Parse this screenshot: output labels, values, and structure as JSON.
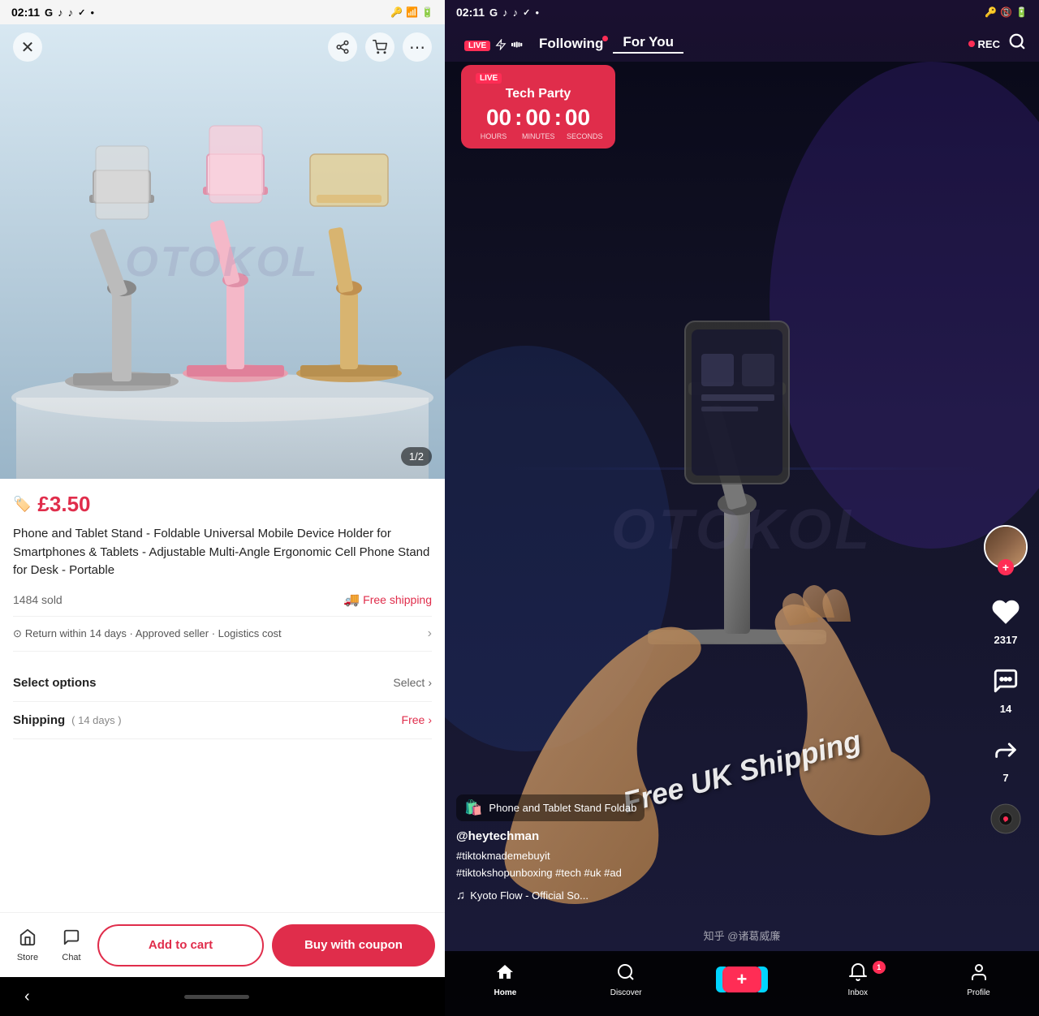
{
  "left": {
    "statusBar": {
      "time": "02:11",
      "icons": [
        "G",
        "tiktok",
        "tiktok2",
        "check",
        "signal"
      ]
    },
    "nav": {
      "close": "×",
      "share": "share",
      "cart": "cart",
      "more": "more"
    },
    "image": {
      "counter": "1/2",
      "altText": "Phone and Tablet Stand product image"
    },
    "product": {
      "priceIcon": "🏷",
      "price": "£3.50",
      "title": "Phone and Tablet Stand - Foldable Universal Mobile Device Holder for Smartphones & Tablets - Adjustable Multi-Angle Ergonomic Cell Phone Stand for Desk - Portable",
      "soldCount": "1484 sold",
      "freeShipping": "Free shipping",
      "returnText": "Return within 14 days · Approved seller · Logistics cost",
      "selectOptions": "Select options",
      "selectBtn": "Select",
      "shippingLabel": "Shipping",
      "shippingDays": "( 14 days )",
      "shippingCost": "Free"
    },
    "bottomBar": {
      "storeLabel": "Store",
      "chatLabel": "Chat",
      "addToCart": "Add to cart",
      "buyWithCoupon": "Buy with coupon"
    }
  },
  "right": {
    "statusBar": {
      "time": "02:11",
      "icons": [
        "G",
        "tiktok",
        "tiktok2",
        "check"
      ]
    },
    "topNav": {
      "live": "LIVE",
      "following": "Following",
      "forYou": "For You",
      "rec": "REC"
    },
    "liveCard": {
      "badge": "LIVE",
      "title": "Tech Party",
      "hours": "00",
      "minutes": "00",
      "seconds": "00",
      "hoursLabel": "HOURS",
      "minutesLabel": "MINUTES",
      "secondsLabel": "SECONDS"
    },
    "freeShippingOverlay": "Free UK Shipping",
    "productCard": {
      "name": "Phone and Tablet Stand  Foldab"
    },
    "userInfo": {
      "username": "@heytechman",
      "hashtags": "#tiktokmademebuyit\n#tiktokshopunboxing #tech #uk #ad",
      "music": "Kyoto Flow - Official So..."
    },
    "actions": {
      "likes": "2317",
      "comments": "14",
      "shares": "7"
    },
    "bottomNav": {
      "homeLabel": "Home",
      "discoverLabel": "Discover",
      "inboxLabel": "Inbox",
      "profileLabel": "Profile",
      "notificationCount": "1"
    },
    "zhihuWatermark": "知乎 @诸葛威廉"
  }
}
